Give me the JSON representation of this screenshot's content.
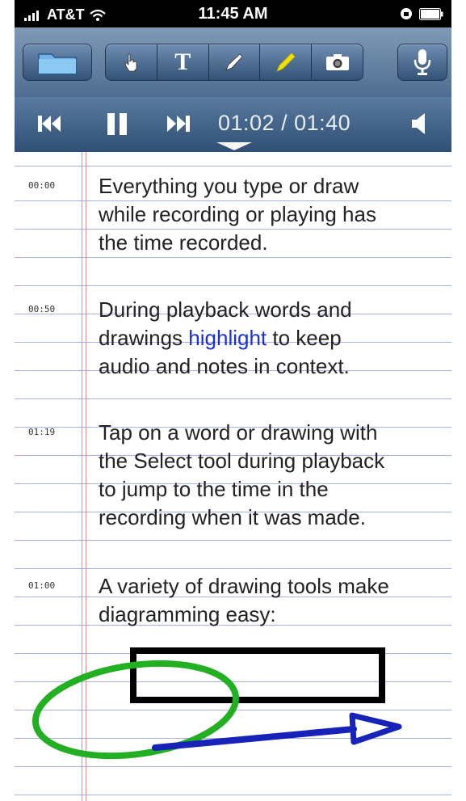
{
  "status_bar": {
    "carrier": "AT&T",
    "time": "11:45 AM"
  },
  "toolbar": {
    "folder_icon": "folder-icon",
    "tools": [
      "select-hand-icon",
      "text-tool-icon",
      "pen-icon",
      "highlighter-icon",
      "camera-icon"
    ],
    "text_tool_label": "T",
    "mic_icon": "microphone-icon",
    "highlighter_color": "#f0e000"
  },
  "transport": {
    "position": "01:02",
    "duration": "01:40",
    "time_display": "01:02 / 01:40"
  },
  "notes": [
    {
      "timestamp": "00:00",
      "lines": [
        "Everything you type or draw",
        "while recording or playing has",
        "the time recorded."
      ]
    },
    {
      "timestamp": "00:50",
      "line1_before": "During playback words and",
      "line2_before": "drawings ",
      "line2_highlight": "highlight",
      "line2_after": " to keep",
      "line3": "audio and notes in context."
    },
    {
      "timestamp": "01:19",
      "lines": [
        "Tap on a word or drawing with",
        "the Select tool during playback",
        "to jump to the time in the",
        "recording when it was made."
      ]
    },
    {
      "timestamp": "01:00",
      "lines": [
        "A variety of drawing tools make",
        "diagramming easy:"
      ]
    }
  ],
  "colors": {
    "highlight_word": "#1a2fe0",
    "ellipse": "#22b022",
    "arrow": "#1722b8",
    "rule_line": "#aab0ee",
    "margin_line": "#e48a8a"
  }
}
